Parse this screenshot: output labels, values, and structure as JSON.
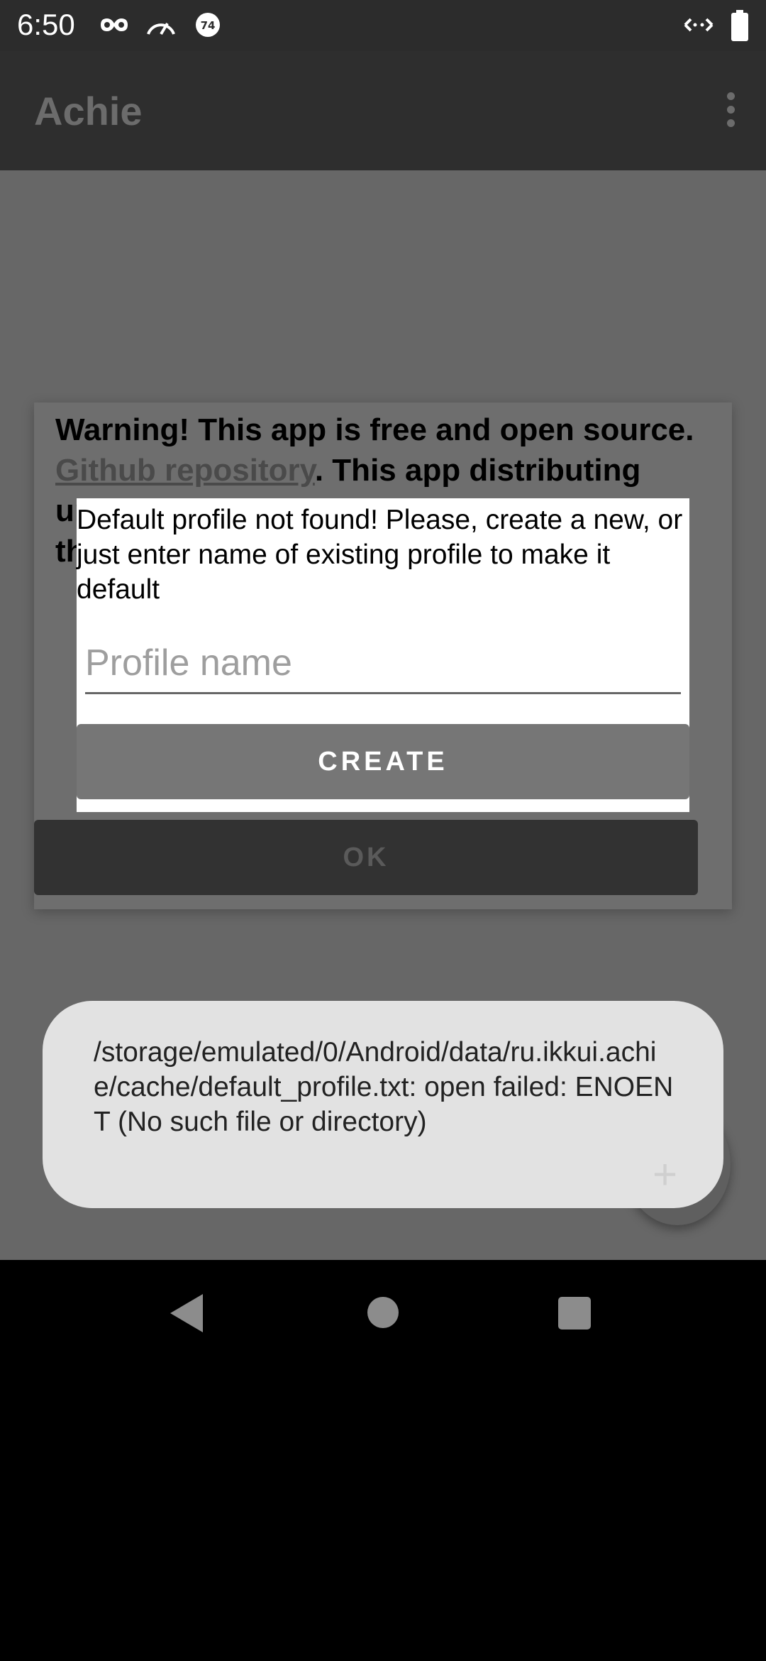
{
  "status_bar": {
    "time": "6:50",
    "left_icons": [
      "incognito-icon",
      "speedometer-icon",
      "notification-badge-icon"
    ],
    "badge_text": "74",
    "right_icons": [
      "data-transfer-icon",
      "battery-icon"
    ]
  },
  "app_bar": {
    "title": "Achie",
    "menu_icon": "overflow-menu-icon"
  },
  "warning_dialog": {
    "text_part1": "Warning! This app is free and open source. ",
    "link_text": "Github repository",
    "text_part2": ". This app distributing under GNU GPL v3 license. If you received this app as a paid, please report it.",
    "ok_label": "OK"
  },
  "profile_dialog": {
    "message": "Default profile not found! Please, create a new, or just enter name of existing profile to make it default",
    "input_placeholder": "Profile name",
    "input_value": "",
    "create_label": "CREATE"
  },
  "toast": {
    "message": "/storage/emulated/0/Android/data/ru.ikkui.achie/cache/default_profile.txt: open failed: ENOENT (No such file or directory)"
  },
  "fab": {
    "icon": "plus-icon",
    "glyph": "+"
  },
  "nav_bar": {
    "icons": [
      "back-icon",
      "home-icon",
      "recents-icon"
    ]
  }
}
